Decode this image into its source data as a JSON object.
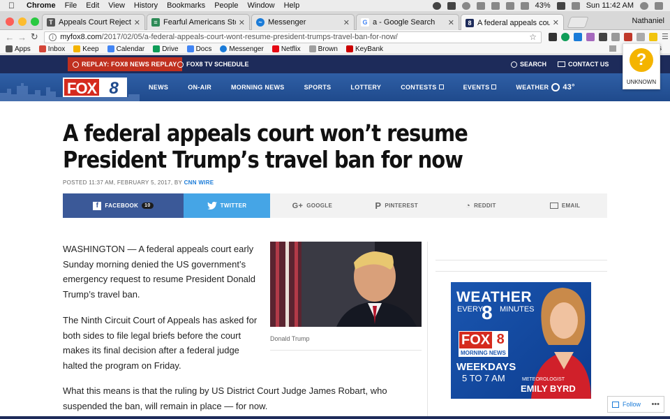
{
  "os_menu": {
    "app": "Chrome",
    "items": [
      "File",
      "Edit",
      "View",
      "History",
      "Bookmarks",
      "People",
      "Window",
      "Help"
    ],
    "battery": "43%",
    "clock": "Sun 11:42 AM"
  },
  "browser": {
    "tabs": [
      {
        "title": "Appeals Court Rejects Reque",
        "favicon_color": "#555555",
        "favicon_char": "T"
      },
      {
        "title": "Fearful Americans Stockpiling",
        "favicon_color": "#2e8b57",
        "favicon_char": "≡"
      },
      {
        "title": "Messenger",
        "favicon_color": "#1a7bd8",
        "favicon_char": "~"
      },
      {
        "title": "a - Google Search",
        "favicon_color": "#4285f4",
        "favicon_char": "G"
      },
      {
        "title": "A federal appeals court won't",
        "favicon_color": "#1d2b5a",
        "favicon_char": "8"
      }
    ],
    "profile_name": "Nathaniel",
    "url_host": "myfox8.com",
    "url_path": "/2017/02/05/a-federal-appeals-court-wont-resume-president-trumps-travel-ban-for-now/",
    "bookmarks": [
      {
        "label": "Apps",
        "color": "#555555"
      },
      {
        "label": "Inbox",
        "color": "#d44638"
      },
      {
        "label": "Keep",
        "color": "#f4b400"
      },
      {
        "label": "Calendar",
        "color": "#4285f4"
      },
      {
        "label": "Drive",
        "color": "#0f9d58"
      },
      {
        "label": "Docs",
        "color": "#4285f4"
      },
      {
        "label": "Messenger",
        "color": "#1a7bd8"
      },
      {
        "label": "Netflix",
        "color": "#e50914"
      },
      {
        "label": "Brown",
        "color": "#a0a0a0"
      },
      {
        "label": "KeyBank",
        "color": "#cc0000"
      }
    ],
    "bookmarks_right": "ks"
  },
  "site_top": {
    "replay": "REPLAY: FOX8 NEWS REPLAY",
    "schedule": "FOX8 TV SCHEDULE",
    "search": "SEARCH",
    "contact": "CONTACT US"
  },
  "logo": {
    "fox": "FOX",
    "num": "8"
  },
  "nav": {
    "items": [
      "NEWS",
      "ON-AIR",
      "MORNING NEWS",
      "SPORTS",
      "LOTTERY",
      "CONTESTS",
      "EVENTS"
    ],
    "weather_label": "WEATHER",
    "weather_temp": "43°"
  },
  "extension_popup": {
    "symbol": "?",
    "label": "UNKNOWN"
  },
  "article": {
    "headline": "A federal appeals court won’t resume President Trump’s travel ban for now",
    "byline_prefix": "POSTED 11:37 AM, FEBRUARY 5, 2017, BY ",
    "byline_source": "CNN WIRE",
    "paragraphs": [
      "WASHINGTON — A federal appeals court early Sunday morning denied the US government’s emergency request to resume President Donald Trump’s travel ban.",
      "The Ninth Circuit Court of Appeals has asked for both sides to file legal briefs before the court makes its final decision after a federal judge halted the program on Friday."
    ],
    "paragraph_wide": "What this means is that the ruling by US District Court Judge James Robart, who suspended the ban, will remain in place — for now.",
    "photo_caption": "Donald Trump"
  },
  "share": {
    "facebook": "FACEBOOK",
    "facebook_count": "10",
    "twitter": "TWITTER",
    "google": "GOOGLE",
    "pinterest": "PINTEREST",
    "reddit": "REDDIT",
    "email": "EMAIL"
  },
  "ad": {
    "weather": "WEATHER",
    "every": "EVERY",
    "eight": "8",
    "minutes": "MINUTES",
    "fox": "FOX",
    "fox_num": "8",
    "morning_news": "MORNING NEWS",
    "weekdays": "WEEKDAYS",
    "time": "5 TO 7 AM",
    "meteorologist": "METEOROLOGIST",
    "name": "EMILY BYRD"
  },
  "follow_widget": {
    "label": "Follow",
    "more": "•••"
  }
}
